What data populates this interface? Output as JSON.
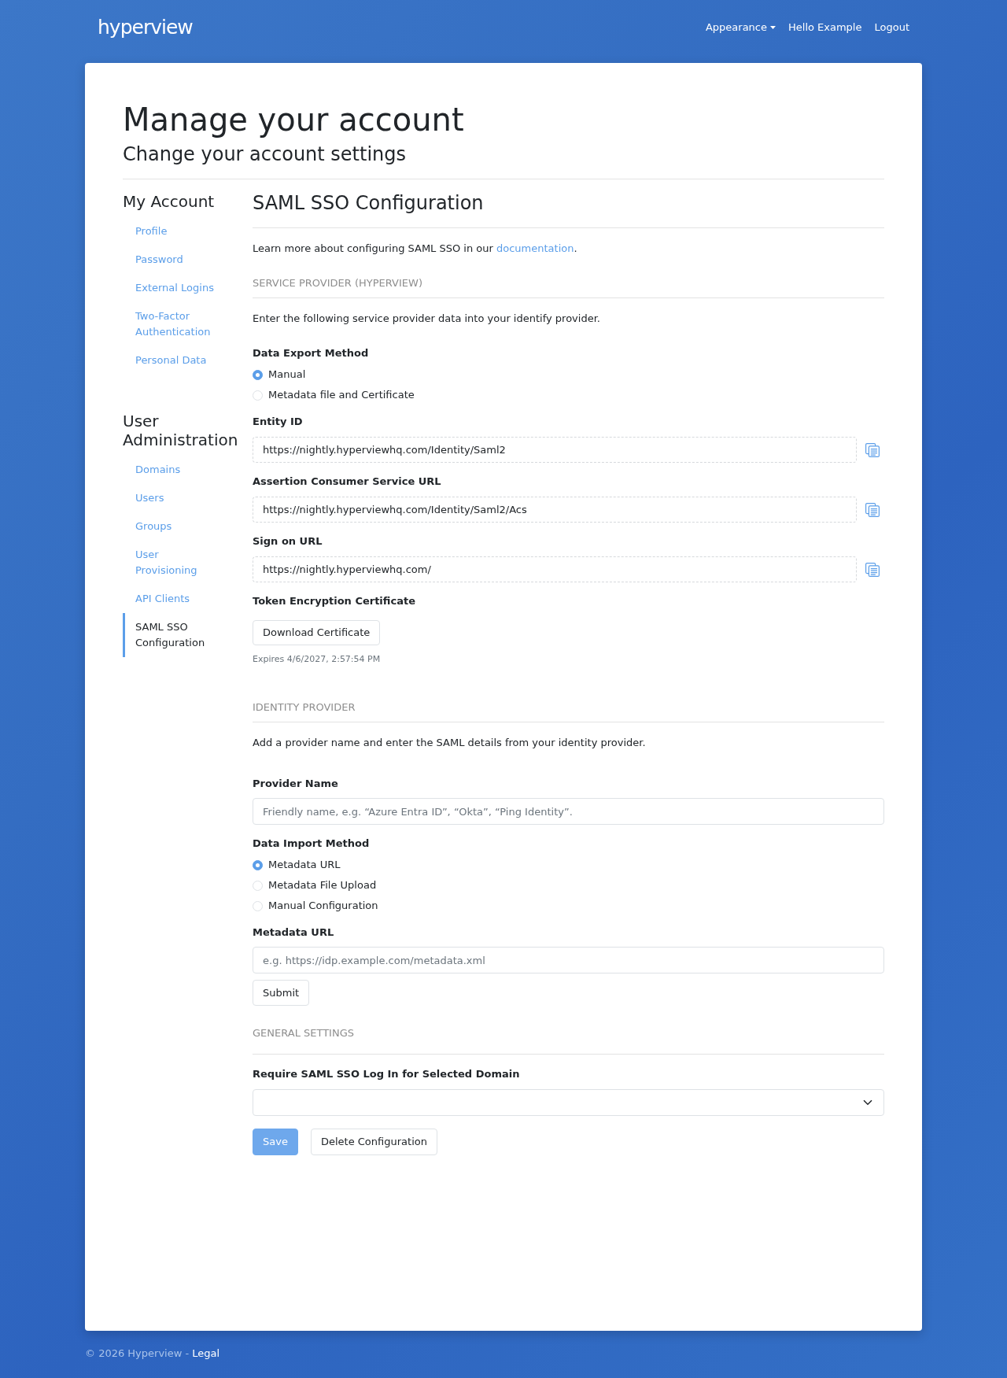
{
  "header": {
    "logo": "hyperview",
    "nav": [
      {
        "kind": "dropdown",
        "label": "Appearance"
      },
      {
        "kind": "link",
        "label": "Hello Example"
      },
      {
        "kind": "link",
        "label": "Logout"
      }
    ]
  },
  "page": {
    "title": "Manage your account",
    "subtitle": "Change your account settings"
  },
  "sidebar": {
    "sections": [
      {
        "heading": "My Account",
        "items": [
          {
            "label": "Profile",
            "selected": false
          },
          {
            "label": "Password",
            "selected": false
          },
          {
            "label": "External Logins",
            "selected": false
          },
          {
            "label": "Two-Factor Authentication",
            "selected": false
          },
          {
            "label": "Personal Data",
            "selected": false
          }
        ]
      },
      {
        "heading": "User Administration",
        "items": [
          {
            "label": "Domains",
            "selected": false
          },
          {
            "label": "Users",
            "selected": false
          },
          {
            "label": "Groups",
            "selected": false
          },
          {
            "label": "User Provisioning",
            "selected": false
          },
          {
            "label": "API Clients",
            "selected": false
          },
          {
            "label": "SAML SSO Configuration",
            "selected": true
          }
        ]
      }
    ]
  },
  "main": {
    "title": "SAML SSO Configuration",
    "intro": {
      "before": "Learn more about configuring SAML SSO in our ",
      "link": "documentation",
      "after": "."
    },
    "sections": [
      {
        "heading": "SERVICE PROVIDER (HYPERVIEW)",
        "description": "Enter the following service provider data into your identify provider.",
        "fields": [
          {
            "kind": "radio",
            "label": "Data Export Method",
            "options": [
              {
                "label": "Manual",
                "selected": true
              },
              {
                "label": "Metadata file and Certificate",
                "selected": false
              }
            ]
          },
          {
            "kind": "copy",
            "label": "Entity ID",
            "value": "https://nightly.hyperviewhq.com/Identity/Saml2"
          },
          {
            "kind": "copy",
            "label": "Assertion Consumer Service URL",
            "value": "https://nightly.hyperviewhq.com/Identity/Saml2/Acs"
          },
          {
            "kind": "copy",
            "label": "Sign on URL",
            "value": "https://nightly.hyperviewhq.com/"
          },
          {
            "kind": "download",
            "label": "Token Encryption Certificate",
            "button": "Download Certificate",
            "note": "Expires 4/6/2027, 2:57:54 PM"
          }
        ]
      },
      {
        "heading": "IDENTITY PROVIDER",
        "description": "Add a provider name and enter the SAML details from your identity provider.",
        "fields": [
          {
            "kind": "text",
            "label": "Provider Name",
            "placeholder": "Friendly name, e.g. “Azure Entra ID”, “Okta”, “Ping Identity”."
          },
          {
            "kind": "radio",
            "label": "Data Import Method",
            "options": [
              {
                "label": "Metadata URL",
                "selected": true
              },
              {
                "label": "Metadata File Upload",
                "selected": false
              },
              {
                "label": "Manual Configuration",
                "selected": false
              }
            ]
          },
          {
            "kind": "text",
            "label": "Metadata URL",
            "placeholder": "e.g. https://idp.example.com/metadata.xml"
          },
          {
            "kind": "button",
            "label": "Submit"
          }
        ]
      },
      {
        "heading": "GENERAL SETTINGS",
        "fields": [
          {
            "kind": "select",
            "label": "Require SAML SSO Log In for Selected Domain"
          }
        ]
      }
    ],
    "actions": [
      {
        "kind": "primary",
        "label": "Save"
      },
      {
        "kind": "secondary",
        "label": "Delete Configuration"
      }
    ]
  },
  "footer": {
    "copyright": "© 2026 Hyperview -",
    "link": "Legal"
  }
}
